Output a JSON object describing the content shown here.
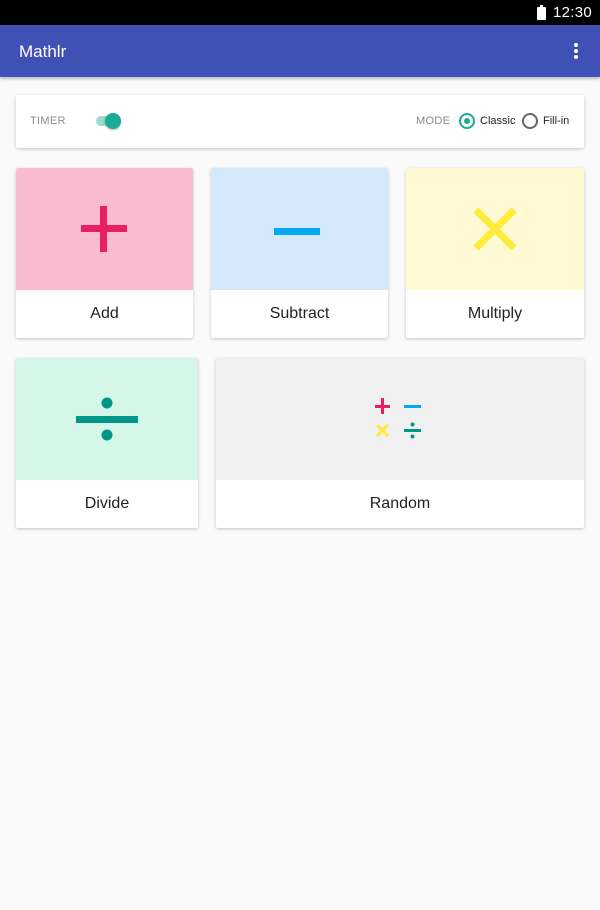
{
  "status_bar": {
    "time": "12:30",
    "battery_icon": "battery-full-icon"
  },
  "app_bar": {
    "title": "Mathlr",
    "menu_icon": "more-vert-icon"
  },
  "settings": {
    "timer_label": "TIMER",
    "timer_on": true,
    "mode_label": "MODE",
    "modes": [
      {
        "label": "Classic",
        "selected": true
      },
      {
        "label": "Fill-in",
        "selected": false
      }
    ]
  },
  "operations": [
    {
      "label": "Add",
      "icon": "plus-icon",
      "bg": "#f8bbd0",
      "color": "#e91e63"
    },
    {
      "label": "Subtract",
      "icon": "minus-icon",
      "bg": "#d4e9fc",
      "color": "#03a9f4"
    },
    {
      "label": "Multiply",
      "icon": "times-icon",
      "bg": "#fff9d4",
      "color": "#ffeb3b"
    },
    {
      "label": "Divide",
      "icon": "divide-icon",
      "bg": "#d5f7ea",
      "color": "#009688"
    },
    {
      "label": "Random",
      "icon": "random-operations-icon",
      "bg": "#f0f0f0",
      "color": "#e91e63"
    }
  ],
  "colors": {
    "primary": "#3f51b5",
    "accent": "#1aab94"
  }
}
